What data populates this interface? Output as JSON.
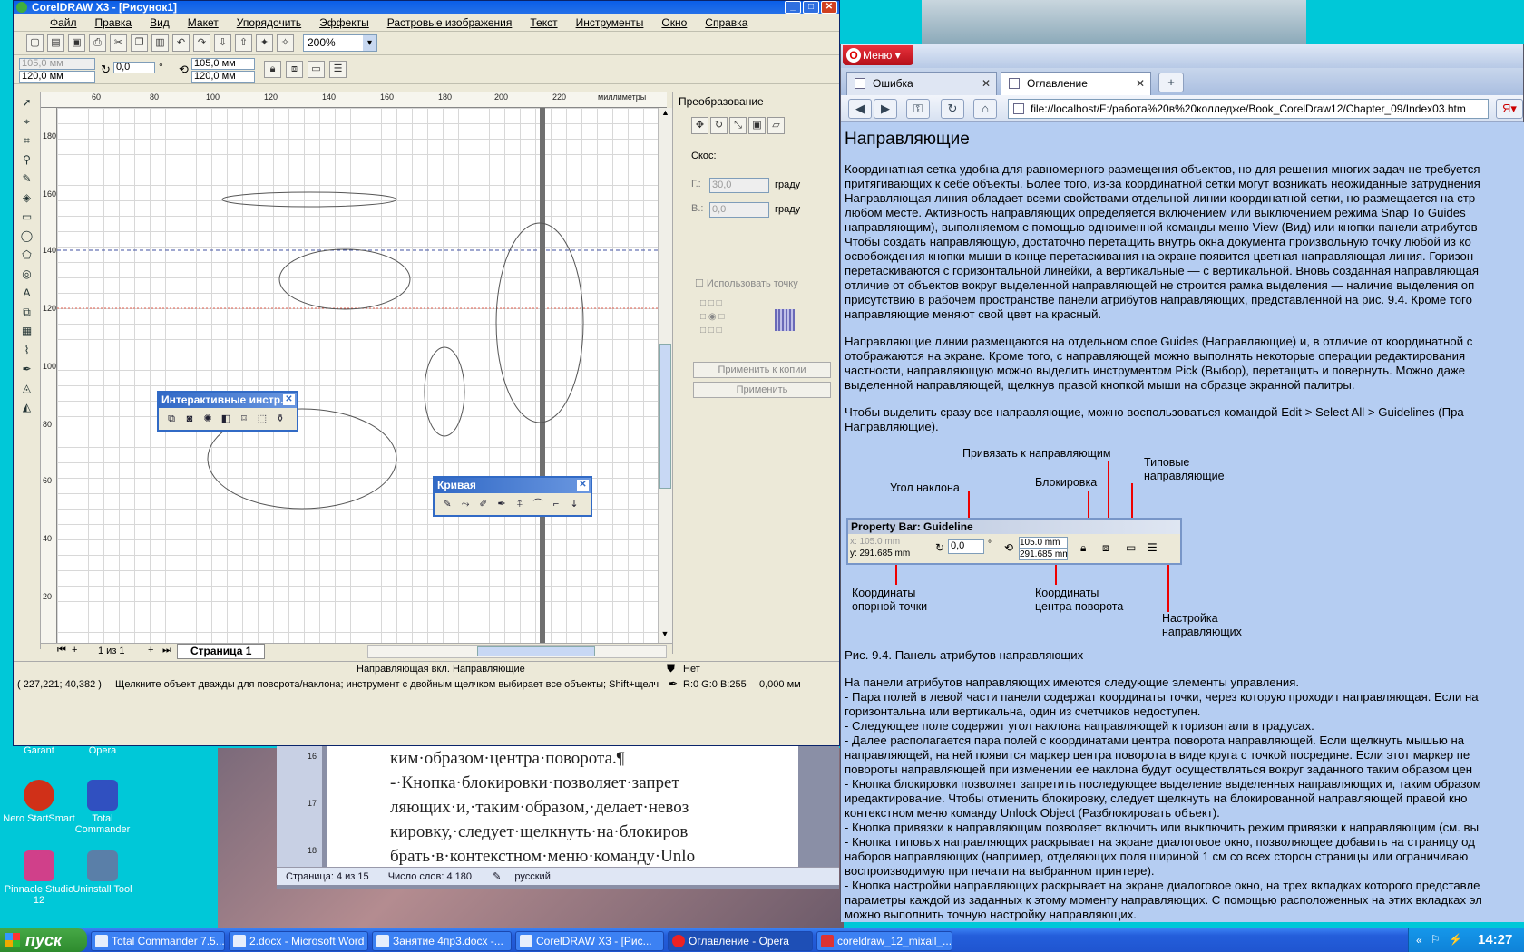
{
  "desktop": {
    "icons_top": [
      {
        "label": "Garant"
      },
      {
        "label": "Opera"
      }
    ],
    "icons": [
      {
        "label": "Nero StartSmart",
        "color": "#d03018"
      },
      {
        "label": "Total Commander",
        "color": "#3050c0"
      },
      {
        "label": "Pinnacle Studio 12",
        "color": "#d0408a"
      },
      {
        "label": "Uninstall Tool",
        "color": "#5a7fa8"
      }
    ]
  },
  "corel": {
    "title": "CorelDRAW X3 - [Рисунок1]",
    "menu": [
      "Файл",
      "Правка",
      "Вид",
      "Макет",
      "Упорядочить",
      "Эффекты",
      "Растровые изображения",
      "Текст",
      "Инструменты",
      "Окно",
      "Справка"
    ],
    "zoom": "200%",
    "propbar": {
      "x": "105,0 мм",
      "y": "120,0 мм",
      "angle": "0,0",
      "degree": "°",
      "cx": "105,0 мм",
      "cy": "120,0 мм"
    },
    "ruler_h": [
      "60",
      "80",
      "100",
      "120",
      "140",
      "160",
      "180",
      "200",
      "220"
    ],
    "ruler_h_unit": "миллиметры",
    "ruler_v": [
      "180",
      "160",
      "140",
      "120",
      "100",
      "80",
      "60",
      "40",
      "20"
    ],
    "ruler_v_unit": "миллиметры",
    "docker": {
      "title": "Преобразование",
      "skew": "Скос:",
      "h_label": "Г.:",
      "h_value": "30,0",
      "h_unit": "граду",
      "v_label": "В.:",
      "v_value": "0,0",
      "v_unit": "граду",
      "use_point": "Использовать точку",
      "apply_copy": "Применить к копии",
      "apply": "Применить"
    },
    "interactive_bar": {
      "title": "Интерактивные инстр..."
    },
    "curve_bar": {
      "title": "Кривая"
    },
    "pagebar": {
      "counter": "1 из 1",
      "page_tab": "Страница 1"
    },
    "status": {
      "guide": "Направляющая вкл. Направляющие",
      "fill": "Нет",
      "coords": "( 227,221; 40,382 )",
      "hint": "Щелкните объект дважды для поворота/наклона; инструмент с двойным щелчком выбирает все объекты; Shift+щелчок - ...",
      "color": "R:0 G:0 B:255",
      "width": "0,000 мм"
    }
  },
  "word": {
    "lines": [
      "ким·образом·центра·поворота.¶",
      "-·Кнопка·блокировки·позволяет·запрет",
      "ляющих·и,·таким·образом,·делает·невоз",
      "кировку,·следует·щелкнуть·на·блокиров",
      "брать·в·контекстном·меню·команду·Unlo"
    ],
    "ruler_nums": [
      "16",
      "17",
      "18"
    ],
    "status": {
      "page": "Страница: 4 из 15",
      "words": "Число слов: 4 180",
      "lang": "русский"
    }
  },
  "opera": {
    "menu": "Меню",
    "tabs": [
      {
        "label": "Ошибка"
      },
      {
        "label": "Оглавление"
      }
    ],
    "url": "file://localhost/F:/работа%20в%20колледже/Book_CorelDraw12/Chapter_09/Index03.htm",
    "heading": "Направляющие",
    "p1": [
      "Координатная сетка удобна для равномерного размещения объектов, но для решения многих задач не требуется",
      "притягивающих к себе объекты. Более того, из-за координатной сетки могут возникать неожиданные затруднения",
      "Направляющая линия обладает всеми свойствами отдельной линии координатной сетки, но размещается на стр",
      "любом месте. Активность направляющих определяется включением или выключением режима Snap To Guides",
      "направляющим), выполняемом с помощью одноименной команды меню View (Вид) или кнопки панели атрибутов",
      "Чтобы создать направляющую, достаточно перетащить внутрь окна документа произвольную точку любой из ко",
      "освобождения кнопки мыши в конце перетаскивания на экране появится цветная направляющая линия. Горизон",
      "перетаскиваются с горизонтальной линейки, а вертикальные — с вертикальной. Вновь созданная направляющая",
      "отличие от объектов вокруг выделенной направляющей не строится рамка выделения — наличие выделения оп",
      "присутствию в рабочем пространстве панели атрибутов направляющих, представленной на рис. 9.4. Кроме того",
      "направляющие меняют свой цвет на красный."
    ],
    "p2": [
      "Направляющие линии размещаются на отдельном слое Guides (Направляющие) и, в отличие от координатной с",
      "отображаются на экране. Кроме того, с направляющей можно выполнять некоторые операции редактирования",
      "частности, направляющую можно выделить инструментом Pick (Выбор), перетащить и повернуть. Можно даже",
      "выделенной направляющей, щелкнув правой кнопкой мыши на образце экранной палитры."
    ],
    "p3": [
      "Чтобы выделить сразу все направляющие, можно воспользоваться командой Edit > Select All > Guidelines (Пра",
      "Направляющие)."
    ],
    "figure": {
      "snap": "Привязать к направляющим",
      "preset": "Типовые направляющие",
      "angle": "Угол наклона",
      "lock": "Блокировка",
      "bar_title": "Property Bar: Guideline",
      "x": "x: 105.0 mm",
      "y": "y: 291.685 mm",
      "ang": "0,0",
      "cx": "105.0 mm",
      "cy": "291.685 mm",
      "ref": "Координаты опорной точки",
      "center": "Координаты центра поворота",
      "settings": "Настройка направляющих"
    },
    "caption": "Рис. 9.4. Панель атрибутов направляющих",
    "p4": [
      "На панели атрибутов направляющих имеются следующие элементы управления.",
      "- Пара полей в левой части панели содержат координаты точки, через которую проходит направляющая. Если на",
      "горизонтальна или вертикальна, один из счетчиков недоступен.",
      "- Следующее поле содержит угол наклона направляющей к горизонтали в градусах.",
      "- Далее располагается пара полей с координатами центра поворота направляющей. Если щелкнуть мышью на",
      "направляющей, на ней появится маркер центра поворота в виде круга с точкой посредине. Если этот маркер пе",
      "повороты направляющей при изменении ее наклона будут осуществляться вокруг заданного таким образом цен",
      "- Кнопка блокировки позволяет запретить последующее выделение выделенных направляющих и, таким образом",
      "иредактирование. Чтобы отменить блокировку, следует щелкнуть на блокированной направляющей правой кно",
      "контекстном меню команду Unlock Object (Разблокировать объект).",
      "- Кнопка привязки к направляющим позволяет включить или выключить режим привязки к направляющим (см. вы",
      "- Кнопка типовых направляющих раскрывает на экране диалоговое окно, позволяющее добавить на страницу од",
      "наборов направляющих (например, отделяющих поля шириной 1 см со всех сторон страницы или ограничиваю",
      "воспроизводимую при печати на выбранном принтере).",
      "- Кнопка настройки направляющих раскрывает на экране диалоговое окно, на трех вкладках которого представле",
      "параметры каждой из заданных к этому моменту направляющих. С помощью расположенных на этих вкладках эл",
      "можно выполнить точную настройку направляющих."
    ]
  },
  "taskbar": {
    "start": "пуск",
    "tasks": [
      {
        "label": "Total Commander 7.5..."
      },
      {
        "label": "2.docx - Microsoft Word"
      },
      {
        "label": "Занятие 4пр3.docx -..."
      },
      {
        "label": "CorelDRAW X3 - [Рис..."
      },
      {
        "label": "Оглавление - Opera"
      },
      {
        "label": "coreldraw_12_mixail_..."
      }
    ],
    "clock": "14:27"
  }
}
